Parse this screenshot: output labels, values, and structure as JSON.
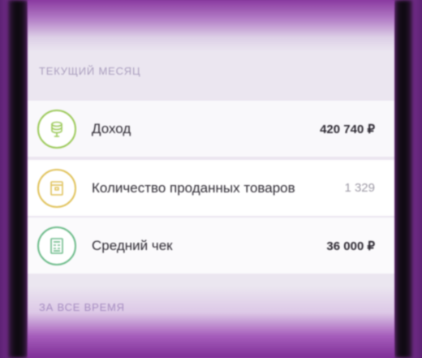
{
  "section_current": {
    "title": "ТЕКУЩИЙ МЕСЯЦ"
  },
  "rows": [
    {
      "label": "Доход",
      "value": "420 740 ₽",
      "icon": "coin-stack-icon",
      "color": "#9cc95a"
    },
    {
      "label": "Количество проданных товаров",
      "value": "1 329",
      "icon": "package-icon",
      "color": "#e0c25a"
    },
    {
      "label": "Средний чек",
      "value": "36 000 ₽",
      "icon": "receipt-icon",
      "color": "#6dbb8a"
    }
  ],
  "section_all_time": {
    "title": "ЗА ВСЕ ВРЕМЯ"
  },
  "colors": {
    "frame_purple": "#8a3aa0",
    "panel_lavender": "#ebe6f0",
    "section_title": "#a99dbd",
    "text_primary": "#2d2932",
    "text_muted": "#9b97a3"
  }
}
